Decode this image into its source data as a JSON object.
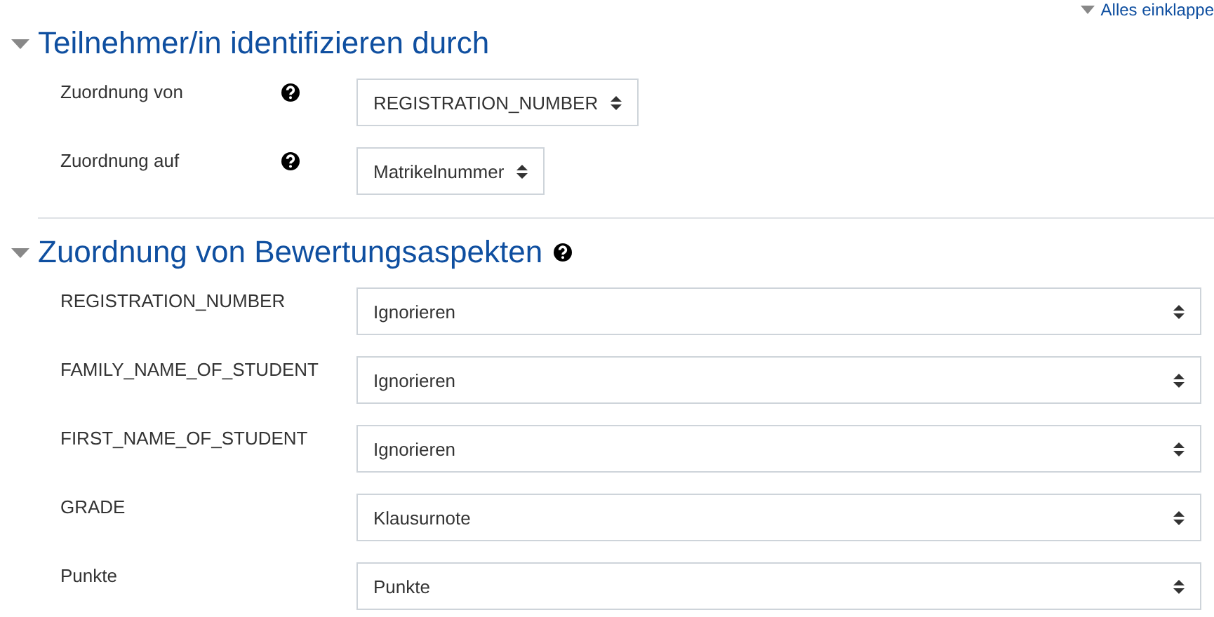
{
  "collapse_link": "Alles einklappe",
  "sections": [
    {
      "title": "Teilnehmer/in identifizieren durch",
      "help": false,
      "kind": "compact",
      "expanded": true,
      "rows": [
        {
          "label": "Zuordnung von",
          "help": true,
          "value": "REGISTRATION_NUMBER"
        },
        {
          "label": "Zuordnung auf",
          "help": true,
          "value": "Matrikelnummer"
        }
      ]
    },
    {
      "title": "Zuordnung von Bewertungsaspekten",
      "help": true,
      "kind": "wide",
      "expanded": true,
      "rows": [
        {
          "label": "REGISTRATION_NUMBER",
          "help": false,
          "value": "Ignorieren"
        },
        {
          "label": "FAMILY_NAME_OF_STUDENT",
          "help": false,
          "value": "Ignorieren"
        },
        {
          "label": "FIRST_NAME_OF_STUDENT",
          "help": false,
          "value": "Ignorieren"
        },
        {
          "label": "GRADE",
          "help": false,
          "value": "Klausurnote"
        },
        {
          "label": "Punkte",
          "help": false,
          "value": "Punkte"
        }
      ]
    }
  ]
}
